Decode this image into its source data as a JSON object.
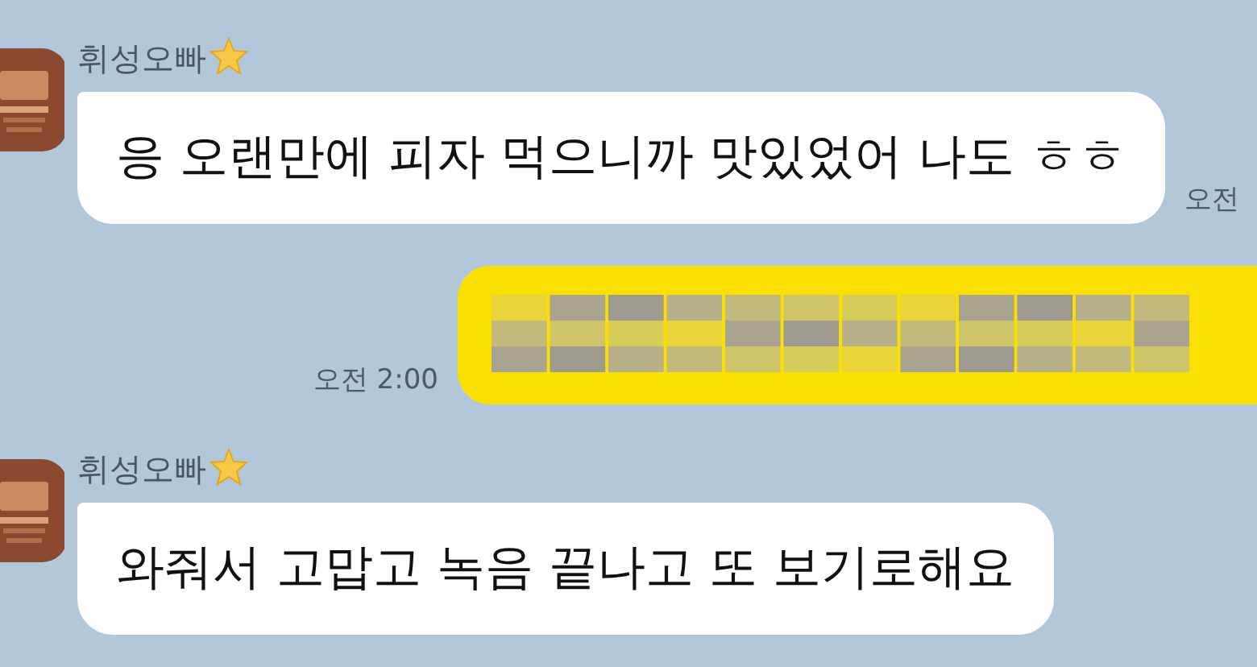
{
  "messages": [
    {
      "kind": "received",
      "sender": "휘성오빠",
      "text": "응 오랜만에 피자 먹으니까 맛있었어 나도 ㅎㅎ",
      "time": "오전"
    },
    {
      "kind": "sent",
      "time": "오전 2:00"
    },
    {
      "kind": "received",
      "sender": "휘성오빠",
      "text": "와줘서 고맙고 녹음 끝나고 또 보기로해요"
    }
  ]
}
